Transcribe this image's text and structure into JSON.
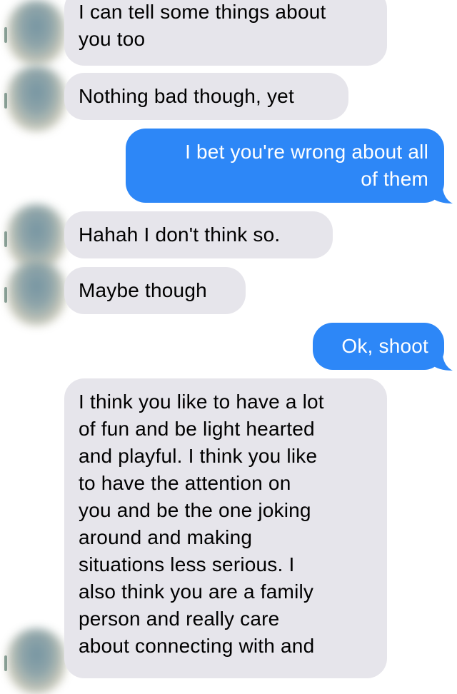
{
  "messages": [
    {
      "id": "m1",
      "direction": "incoming",
      "lines": [
        "I can tell some things about",
        "you too"
      ]
    },
    {
      "id": "m2",
      "direction": "incoming",
      "lines": [
        "Nothing bad though, yet"
      ]
    },
    {
      "id": "m3",
      "direction": "outgoing",
      "lines": [
        "I bet you're wrong about all",
        "of them"
      ]
    },
    {
      "id": "m4",
      "direction": "incoming",
      "lines": [
        "Hahah I don't think so."
      ]
    },
    {
      "id": "m5",
      "direction": "incoming",
      "lines": [
        "Maybe though"
      ]
    },
    {
      "id": "m6",
      "direction": "outgoing",
      "lines": [
        "Ok, shoot"
      ]
    },
    {
      "id": "m7",
      "direction": "incoming",
      "lines": [
        "I think you like to have a lot",
        "of fun and be light hearted",
        "and playful. I think you like",
        "to have the attention on",
        "you and be the one joking",
        "around and making",
        "situations less serious. I",
        "also think you are a family",
        "person and really care",
        "about connecting with and"
      ]
    }
  ],
  "colors": {
    "incoming_bubble": "#e6e5eb",
    "outgoing_bubble": "#2d87f7",
    "outgoing_text": "#ffffff",
    "incoming_text": "#000000"
  },
  "icons": {
    "avatar": "contact-avatar-icon"
  }
}
